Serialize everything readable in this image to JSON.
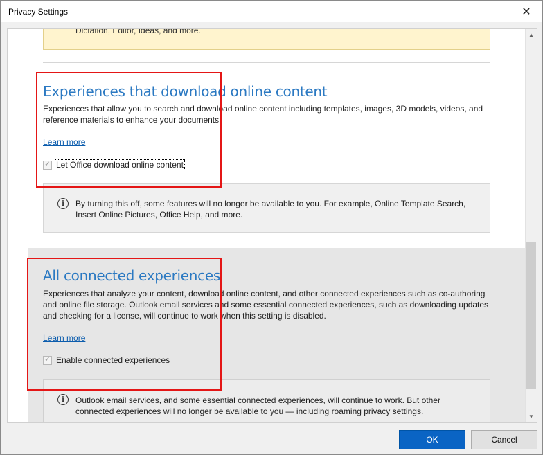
{
  "window": {
    "title": "Privacy Settings",
    "close_glyph": "✕"
  },
  "top_notice": {
    "text": "Dictation, Editor, Ideas, and more."
  },
  "download_section": {
    "title": "Experiences that download online content",
    "description": "Experiences that allow you to search and download online content including templates, images, 3D models, videos, and reference materials to enhance your documents.",
    "learn_more": "Learn more",
    "checkbox_label": "Let Office download online content",
    "checked": true,
    "info": "By turning this off, some features will no longer be available to you. For example, Online Template Search, Insert Online Pictures, Office Help, and more."
  },
  "connected_section": {
    "title": "All connected experiences",
    "description": "Experiences that analyze your content, download online content, and other connected experiences such as co-authoring and online file storage. Outlook email services and some essential connected experiences, such as downloading updates and checking for a license, will continue to work when this setting is disabled.",
    "learn_more": "Learn more",
    "checkbox_label": "Enable connected experiences",
    "checked": true,
    "info": "Outlook email services, and some essential connected experiences, will continue to work. But other connected experiences will no longer be available to you — including roaming privacy settings."
  },
  "glyphs": {
    "check": "✓",
    "info": "i",
    "scroll_up": "▲",
    "scroll_down": "▼"
  },
  "buttons": {
    "ok": "OK",
    "cancel": "Cancel"
  },
  "colors": {
    "heading": "#2b79c2",
    "link": "#0b5cad",
    "primary_button": "#0a64c4",
    "highlight_box": "#e41616",
    "notice_bg": "#fff4ce"
  }
}
